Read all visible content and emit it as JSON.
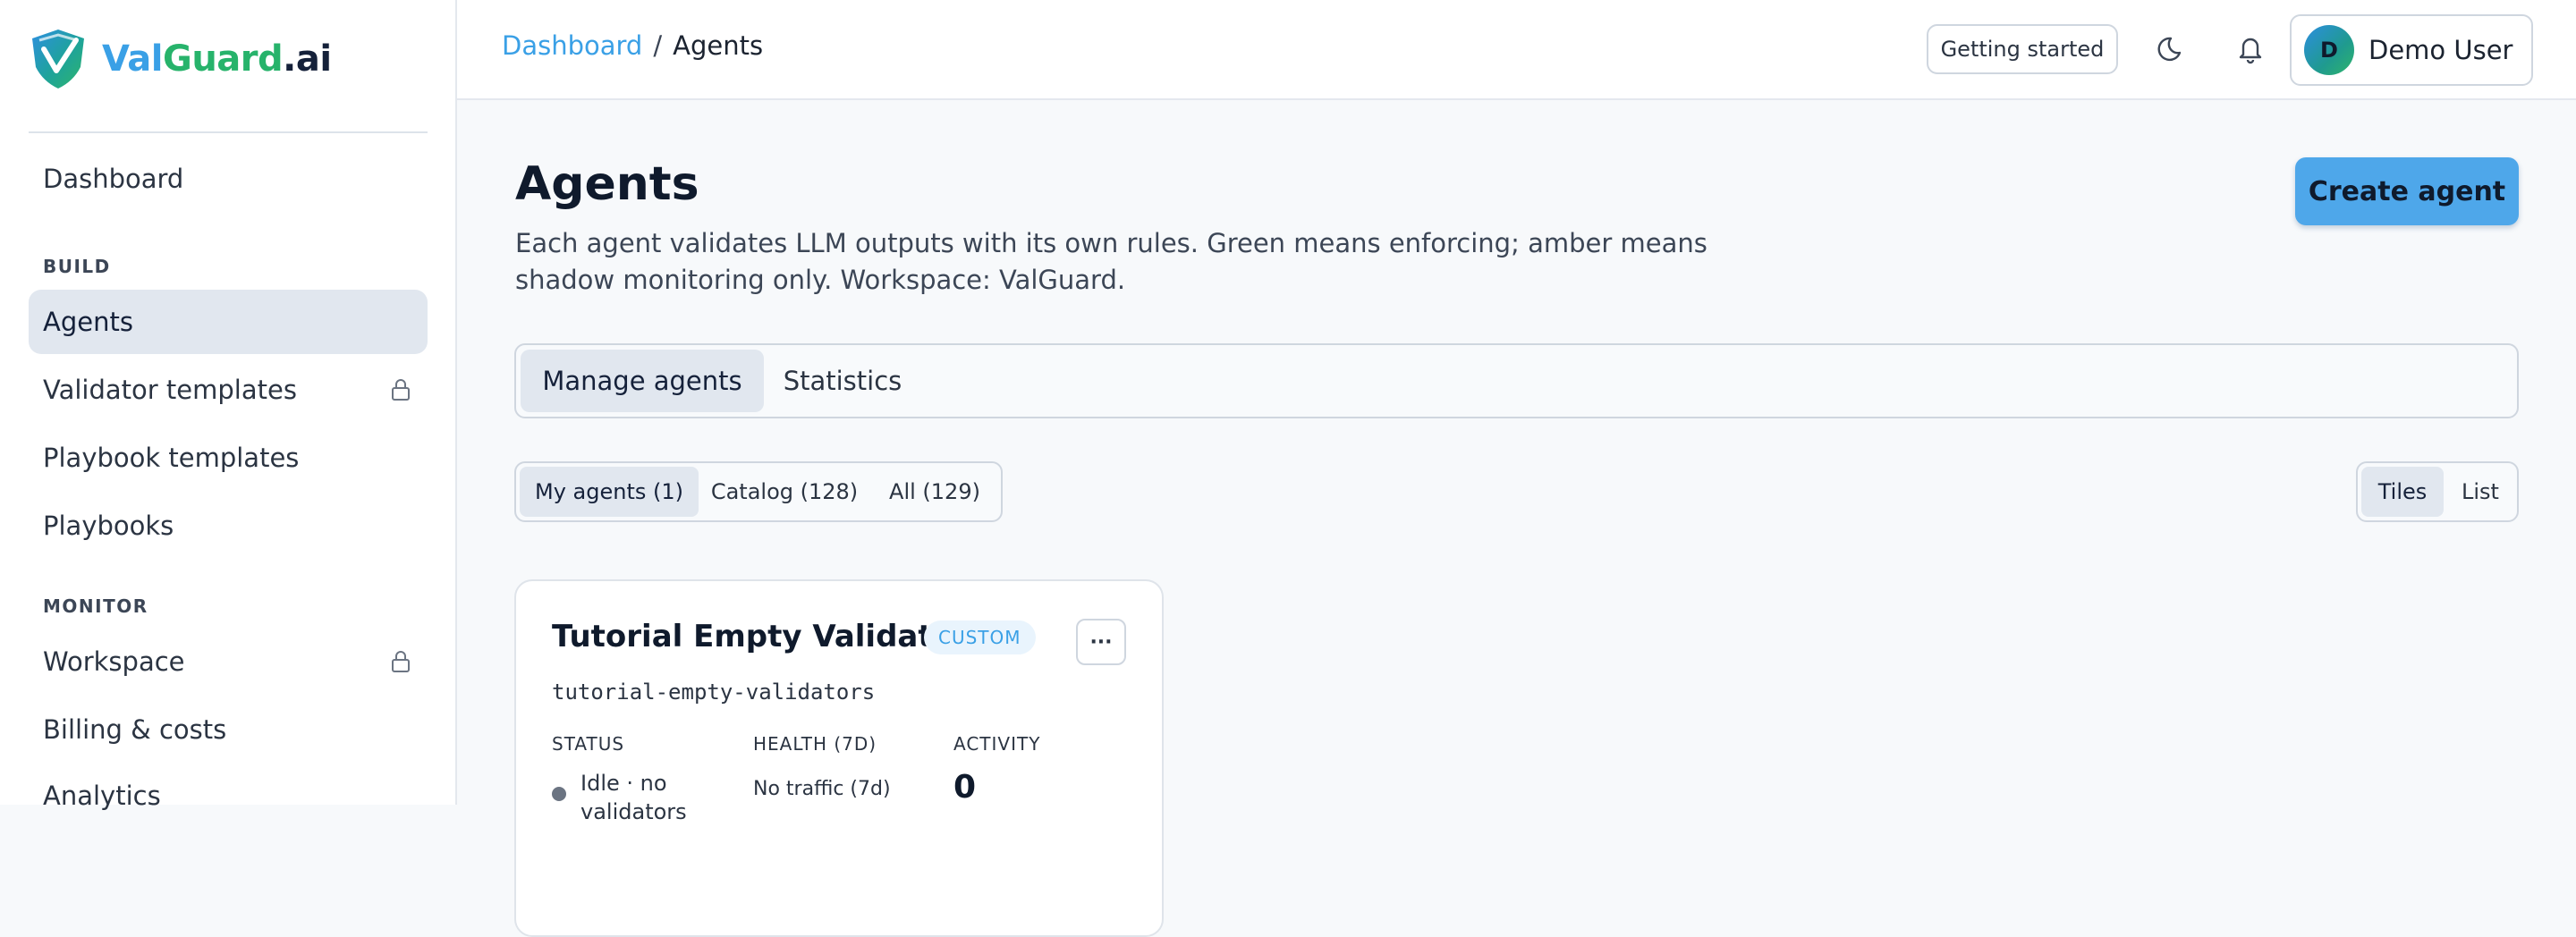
{
  "brand": {
    "part1": "Val",
    "part2": "Guard",
    "part3": ".ai"
  },
  "sidebar": {
    "dashboard": "Dashboard",
    "build_label": "BUILD",
    "build_items": [
      {
        "label": "Agents",
        "active": true
      },
      {
        "label": "Validator templates",
        "locked": true
      },
      {
        "label": "Playbook templates"
      },
      {
        "label": "Playbooks"
      }
    ],
    "monitor_label": "MONITOR",
    "monitor_items": [
      {
        "label": "Workspace",
        "locked": true
      },
      {
        "label": "Billing & costs"
      },
      {
        "label": "Analytics"
      }
    ]
  },
  "topbar": {
    "breadcrumb": {
      "root": "Dashboard",
      "sep": "/",
      "current": "Agents"
    },
    "getting_started": "Getting started",
    "user": {
      "initial": "D",
      "name": "Demo User"
    }
  },
  "page": {
    "title": "Agents",
    "description": "Each agent validates LLM outputs with its own rules. Green means enforcing; amber means shadow monitoring only. Workspace: ValGuard.",
    "create_button": "Create agent"
  },
  "tabs": [
    {
      "label": "Manage agents",
      "active": true
    },
    {
      "label": "Statistics"
    }
  ],
  "filters": [
    {
      "label": "My agents (1)",
      "active": true
    },
    {
      "label": "Catalog (128)"
    },
    {
      "label": "All (129)"
    }
  ],
  "view_toggle": [
    {
      "label": "Tiles",
      "active": true
    },
    {
      "label": "List"
    }
  ],
  "agent_card": {
    "title": "Tutorial Empty Validators",
    "badge": "CUSTOM",
    "more": "···",
    "slug": "tutorial-empty-validators",
    "status_label": "STATUS",
    "health_label": "HEALTH (7D)",
    "activity_label": "ACTIVITY",
    "status_value": "Idle · no validators",
    "health_value": "No traffic (7d)",
    "activity_value": "0"
  },
  "colors": {
    "accent": "#3aa0e6",
    "brand_green": "#27b36b",
    "primary_button": "#4ea7ea",
    "active_bg": "#e1e7ef"
  },
  "icons": [
    "shield-logo-icon",
    "lock-icon",
    "moon-icon",
    "bell-icon",
    "more-icon"
  ]
}
